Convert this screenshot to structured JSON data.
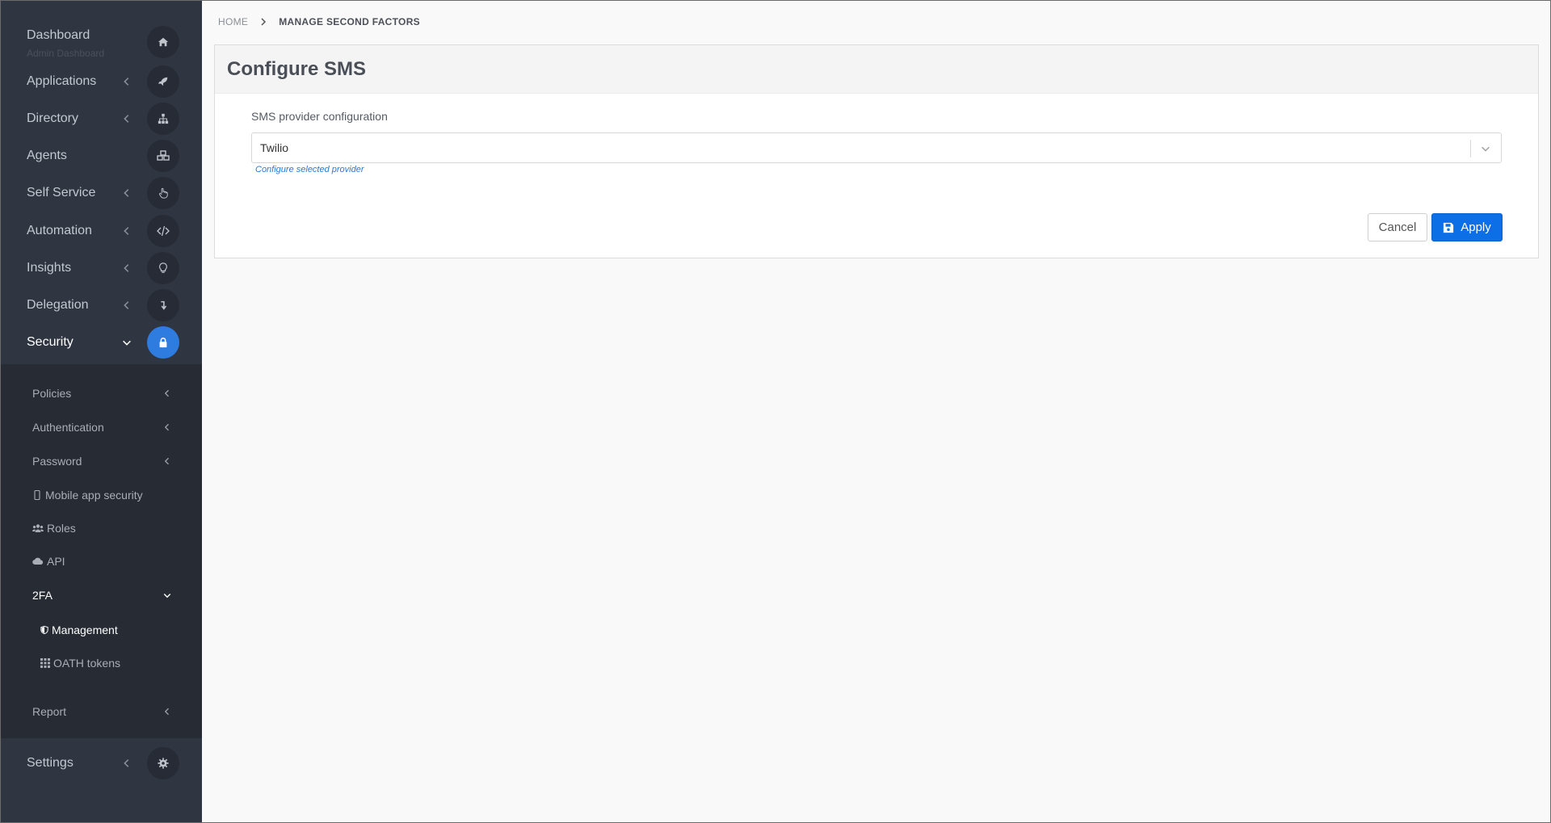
{
  "sidebar": {
    "dashboard": {
      "label": "Dashboard",
      "sub": "Admin Dashboard",
      "icon": "home-icon"
    },
    "applications": {
      "label": "Applications",
      "icon": "rocket-icon"
    },
    "directory": {
      "label": "Directory",
      "icon": "sitemap-icon"
    },
    "agents": {
      "label": "Agents",
      "icon": "cubes-icon"
    },
    "self_service": {
      "label": "Self Service",
      "icon": "hand-pointer-icon"
    },
    "automation": {
      "label": "Automation",
      "icon": "code-icon"
    },
    "insights": {
      "label": "Insights",
      "icon": "lightbulb-icon"
    },
    "delegation": {
      "label": "Delegation",
      "icon": "level-down-icon"
    },
    "security": {
      "label": "Security",
      "icon": "lock-icon",
      "expanded": true
    },
    "settings": {
      "label": "Settings",
      "icon": "gear-icon"
    },
    "security_items": {
      "policies": "Policies",
      "authentication": "Authentication",
      "password": "Password",
      "mobile_app_security": "Mobile app security",
      "roles": "Roles",
      "api": "API",
      "twofa": "2FA",
      "management": "Management",
      "oath_tokens": "OATH tokens",
      "report": "Report"
    }
  },
  "breadcrumb": {
    "home": "HOME",
    "current": "MANAGE SECOND FACTORS"
  },
  "panel": {
    "title": "Configure SMS",
    "field_label": "SMS provider configuration",
    "select_value": "Twilio",
    "select_link": "Configure selected provider",
    "cancel_label": "Cancel",
    "apply_label": "Apply"
  },
  "colors": {
    "sidebar_bg": "#2f3541",
    "active_accent": "#2e7ce0",
    "primary_button": "#0d6fe6"
  }
}
